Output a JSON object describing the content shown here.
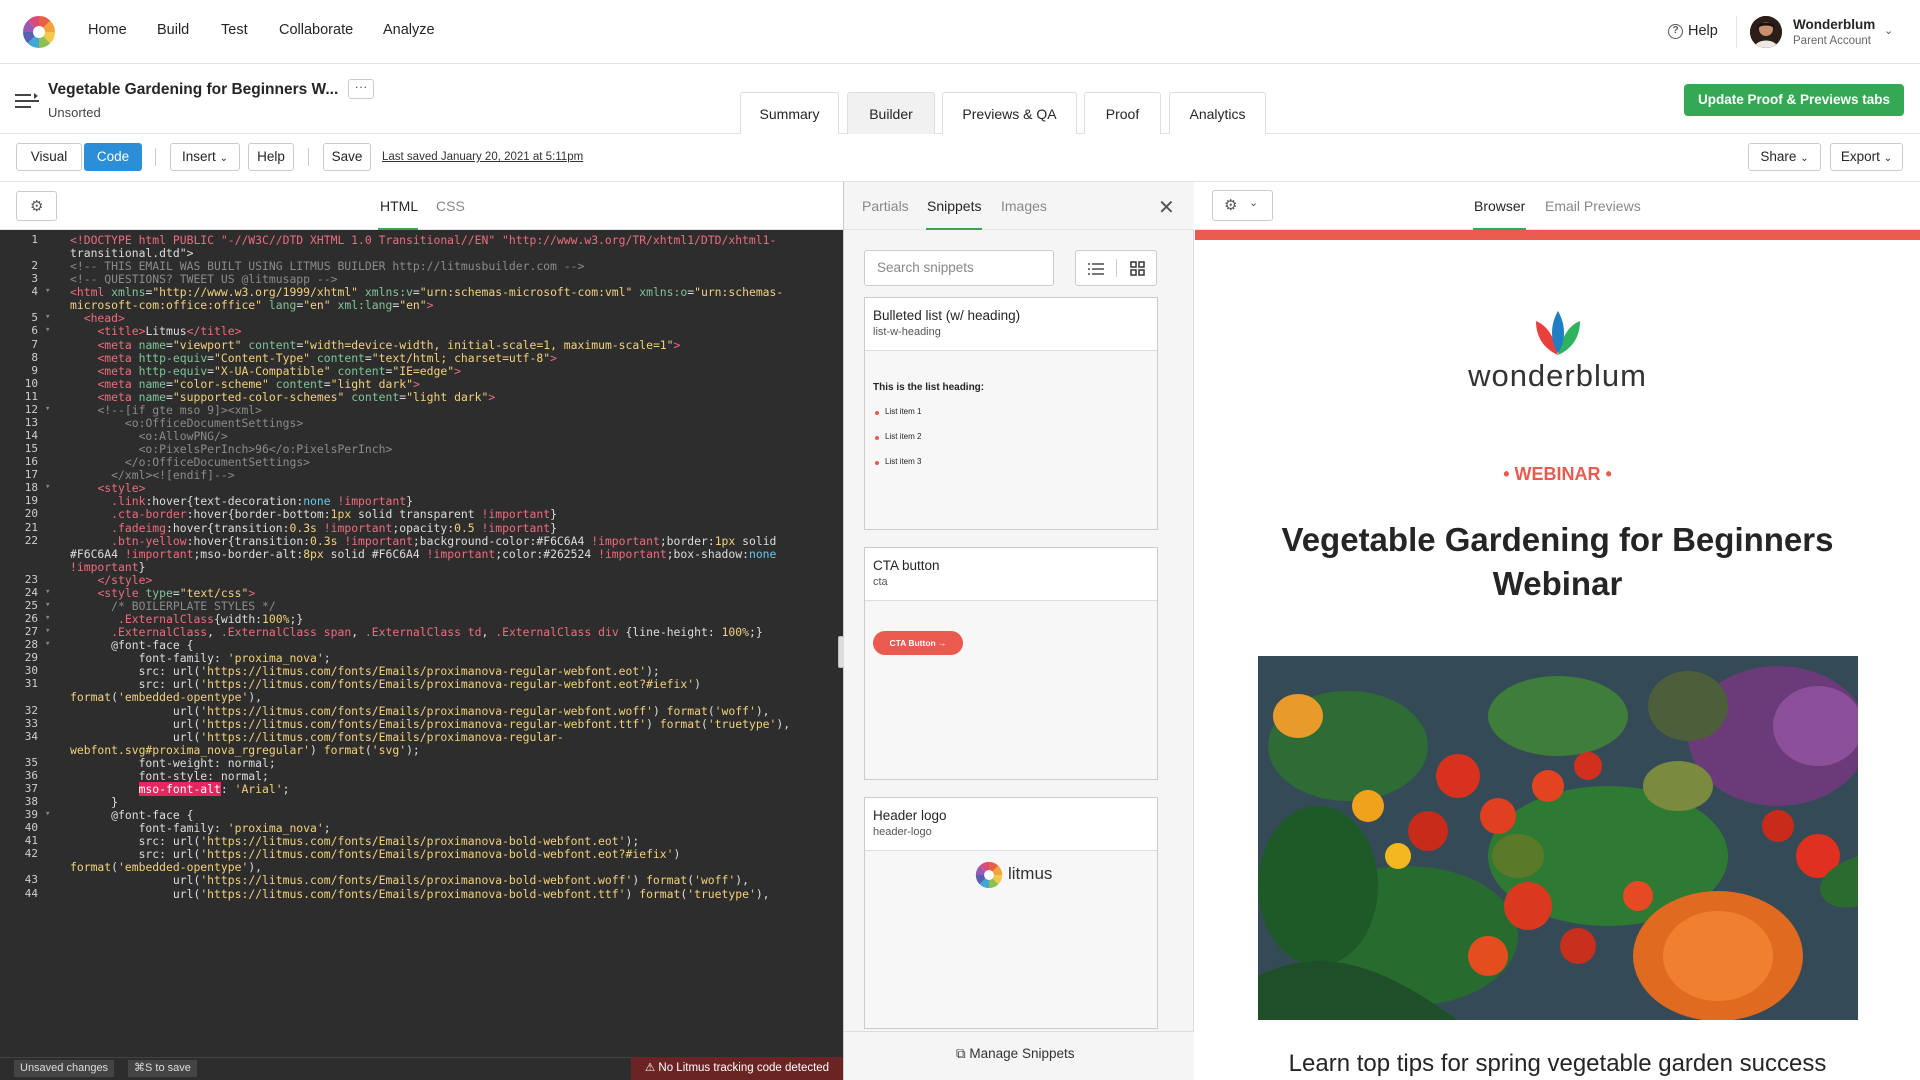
{
  "nav": {
    "items": [
      "Home",
      "Build",
      "Test",
      "Collaborate",
      "Analyze"
    ],
    "help": "Help"
  },
  "account": {
    "name": "Wonderblum",
    "sub": "Parent Account"
  },
  "project": {
    "title": "Vegetable Gardening for Beginners W...",
    "folder": "Unsorted",
    "more": "···"
  },
  "tabs": [
    "Summary",
    "Builder",
    "Previews & QA",
    "Proof",
    "Analytics"
  ],
  "active_tab": "Builder",
  "update_button": "Update Proof & Previews tabs",
  "toolbar": {
    "visual": "Visual",
    "code": "Code",
    "insert": "Insert",
    "help": "Help",
    "save": "Save",
    "last_saved": "Last saved January 20, 2021 at 5:11pm",
    "share": "Share",
    "export": "Export"
  },
  "editor": {
    "tabs": [
      "HTML",
      "CSS"
    ],
    "lines": [
      {
        "n": "1",
        "f": "",
        "y": 0,
        "html": "<span class='k'>&lt;!DOCTYPE html PUBLIC \"-//W3C//DTD XHTML 1.0 Transitional//EN\" \"http://www.w3.org/TR/xhtml1/DTD/xhtml1-</span>"
      },
      {
        "n": "",
        "f": "",
        "y": 1,
        "html": "<span class='v'>transitional.dtd\"&gt;</span>"
      },
      {
        "n": "2",
        "f": "",
        "y": 2,
        "html": "<span class='c'>&lt;!-- THIS EMAIL WAS BUILT USING LITMUS BUILDER http://litmusbuilder.com --&gt;</span>"
      },
      {
        "n": "3",
        "f": "",
        "y": 3,
        "html": "<span class='c'>&lt;!-- QUESTIONS? TWEET US @litmusapp --&gt;</span>"
      },
      {
        "n": "4",
        "f": "▾",
        "y": 4,
        "html": "<span class='k'>&lt;html</span> <span class='a'>xmlns</span>=<span class='s'>\"http://www.w3.org/1999/xhtml\"</span> <span class='a'>xmlns:v</span>=<span class='s'>\"urn:schemas-microsoft-com:vml\"</span> <span class='a'>xmlns:o</span>=<span class='s'>\"urn:schemas-</span>"
      },
      {
        "n": "",
        "f": "",
        "y": 5,
        "html": "<span class='s'>microsoft-com:office:office\"</span> <span class='a'>lang</span>=<span class='s'>\"en\"</span> <span class='a'>xml:lang</span>=<span class='s'>\"en\"</span><span class='k'>&gt;</span>"
      },
      {
        "n": "5",
        "f": "▾",
        "y": 6,
        "html": "  <span class='k'>&lt;head&gt;</span>"
      },
      {
        "n": "6",
        "f": "▾",
        "y": 7,
        "html": "    <span class='k'>&lt;title&gt;</span><span class='v'>Litmus</span><span class='k'>&lt;/title&gt;</span>"
      },
      {
        "n": "7",
        "f": "",
        "y": 8,
        "html": "    <span class='k'>&lt;meta</span> <span class='a'>name</span>=<span class='s'>\"viewport\"</span> <span class='a'>content</span>=<span class='s'>\"width=device-width, initial-scale=1, maximum-scale=1\"</span><span class='k'>&gt;</span>"
      },
      {
        "n": "8",
        "f": "",
        "y": 9,
        "html": "    <span class='k'>&lt;meta</span> <span class='a'>http-equiv</span>=<span class='s'>\"Content-Type\"</span> <span class='a'>content</span>=<span class='s'>\"text/html; charset=utf-8\"</span><span class='k'>&gt;</span>"
      },
      {
        "n": "9",
        "f": "",
        "y": 10,
        "html": "    <span class='k'>&lt;meta</span> <span class='a'>http-equiv</span>=<span class='s'>\"X-UA-Compatible\"</span> <span class='a'>content</span>=<span class='s'>\"IE=edge\"</span><span class='k'>&gt;</span>"
      },
      {
        "n": "10",
        "f": "",
        "y": 11,
        "html": "    <span class='k'>&lt;meta</span> <span class='a'>name</span>=<span class='s'>\"color-scheme\"</span> <span class='a'>content</span>=<span class='s'>\"light dark\"</span><span class='k'>&gt;</span>"
      },
      {
        "n": "11",
        "f": "",
        "y": 12,
        "html": "    <span class='k'>&lt;meta</span> <span class='a'>name</span>=<span class='s'>\"supported-color-schemes\"</span> <span class='a'>content</span>=<span class='s'>\"light dark\"</span><span class='k'>&gt;</span>"
      },
      {
        "n": "12",
        "f": "▾",
        "y": 13,
        "html": "    <span class='c'>&lt;!--[if gte mso 9]&gt;&lt;xml&gt;</span>"
      },
      {
        "n": "13",
        "f": "",
        "y": 14,
        "html": "        <span class='c'>&lt;o:OfficeDocumentSettings&gt;</span>"
      },
      {
        "n": "14",
        "f": "",
        "y": 15,
        "html": "          <span class='c'>&lt;o:AllowPNG/&gt;</span>"
      },
      {
        "n": "15",
        "f": "",
        "y": 16,
        "html": "          <span class='c'>&lt;o:PixelsPerInch&gt;96&lt;/o:PixelsPerInch&gt;</span>"
      },
      {
        "n": "16",
        "f": "",
        "y": 17,
        "html": "        <span class='c'>&lt;/o:OfficeDocumentSettings&gt;</span>"
      },
      {
        "n": "17",
        "f": "",
        "y": 18,
        "html": "      <span class='c'>&lt;/xml&gt;&lt;![endif]--&gt;</span>"
      },
      {
        "n": "18",
        "f": "▾",
        "y": 19,
        "html": "    <span class='k'>&lt;style&gt;</span>"
      },
      {
        "n": "19",
        "f": "",
        "y": 20,
        "html": "      <span class='k'>.link</span>:hover{text-decoration:<span class='p'>none</span> <span class='k'>!important</span>}"
      },
      {
        "n": "20",
        "f": "",
        "y": 21,
        "html": "      <span class='k'>.cta-border</span>:hover{border-bottom:<span class='s'>1px</span> solid transparent <span class='k'>!important</span>}"
      },
      {
        "n": "21",
        "f": "",
        "y": 22,
        "html": "      <span class='k'>.fadeimg</span>:hover{transition:<span class='s'>0.3s</span> <span class='k'>!important</span>;opacity:<span class='s'>0.5</span> <span class='k'>!important</span>}"
      },
      {
        "n": "22",
        "f": "",
        "y": 23,
        "html": "      <span class='k'>.btn-yellow</span>:hover{transition:<span class='s'>0.3s</span> <span class='k'>!important</span>;background-color:#F6C6A4 <span class='k'>!important</span>;border:<span class='s'>1px</span> solid"
      },
      {
        "n": "",
        "f": "",
        "y": 24,
        "html": "#F6C6A4 <span class='k'>!important</span>;mso-border-alt:<span class='s'>8px</span> solid #F6C6A4 <span class='k'>!important</span>;color:#262524 <span class='k'>!important</span>;box-shadow:<span class='p'>none</span>"
      },
      {
        "n": "",
        "f": "",
        "y": 25,
        "html": "<span class='k'>!important</span>}"
      },
      {
        "n": "23",
        "f": "",
        "y": 26,
        "html": "    <span class='k'>&lt;/style&gt;</span>"
      },
      {
        "n": "24",
        "f": "▾",
        "y": 27,
        "html": "    <span class='k'>&lt;style</span> <span class='a'>type</span>=<span class='s'>\"text/css\"</span><span class='k'>&gt;</span>"
      },
      {
        "n": "25",
        "f": "▾",
        "y": 28,
        "html": "      <span class='c'>/* BOILERPLATE STYLES */</span>"
      },
      {
        "n": "26",
        "f": "▾",
        "y": 29,
        "html": "       <span class='k'>.ExternalClass</span>{width:<span class='s'>100%</span>;}"
      },
      {
        "n": "27",
        "f": "▾",
        "y": 30,
        "html": "      <span class='k'>.ExternalClass</span>, <span class='k'>.ExternalClass span</span>, <span class='k'>.ExternalClass td</span>, <span class='k'>.ExternalClass div</span> {line-height: <span class='s'>100%</span>;}"
      },
      {
        "n": "28",
        "f": "▾",
        "y": 31,
        "html": "      <span class='v'>@font-face</span> {"
      },
      {
        "n": "29",
        "f": "",
        "y": 32,
        "html": "          font-family: <span class='s'>'proxima_nova'</span>;"
      },
      {
        "n": "30",
        "f": "",
        "y": 33,
        "html": "          src: url(<span class='s'>'https://litmus.com/fonts/Emails/proximanova-regular-webfont.eot'</span>);"
      },
      {
        "n": "31",
        "f": "",
        "y": 34,
        "html": "          src: url(<span class='s'>'https://litmus.com/fonts/Emails/proximanova-regular-webfont.eot?#iefix'</span>)"
      },
      {
        "n": "",
        "f": "",
        "y": 35,
        "html": "<span class='s'>format</span>(<span class='s'>'embedded-opentype'</span>),"
      },
      {
        "n": "32",
        "f": "",
        "y": 36,
        "html": "               url(<span class='s'>'https://litmus.com/fonts/Emails/proximanova-regular-webfont.woff'</span>) <span class='s'>format</span>(<span class='s'>'woff'</span>),"
      },
      {
        "n": "33",
        "f": "",
        "y": 37,
        "html": "               url(<span class='s'>'https://litmus.com/fonts/Emails/proximanova-regular-webfont.ttf'</span>) <span class='s'>format</span>(<span class='s'>'truetype'</span>),"
      },
      {
        "n": "34",
        "f": "",
        "y": 38,
        "html": "               url(<span class='s'>'https://litmus.com/fonts/Emails/proximanova-regular-</span>"
      },
      {
        "n": "",
        "f": "",
        "y": 39,
        "html": "<span class='s'>webfont.svg#proxima_nova_rgregular'</span>) <span class='s'>format</span>(<span class='s'>'svg'</span>);"
      },
      {
        "n": "35",
        "f": "",
        "y": 40,
        "html": "          font-weight: normal;"
      },
      {
        "n": "36",
        "f": "",
        "y": 41,
        "html": "          font-style: normal;"
      },
      {
        "n": "37",
        "f": "",
        "y": 42,
        "html": "          <span class='hl'>mso-font-alt</span>: <span class='s'>'Arial'</span>;"
      },
      {
        "n": "38",
        "f": "",
        "y": 43,
        "html": "      }"
      },
      {
        "n": "39",
        "f": "▾",
        "y": 44,
        "html": "      <span class='v'>@font-face</span> {"
      },
      {
        "n": "40",
        "f": "",
        "y": 45,
        "html": "          font-family: <span class='s'>'proxima_nova'</span>;"
      },
      {
        "n": "41",
        "f": "",
        "y": 46,
        "html": "          src: url(<span class='s'>'https://litmus.com/fonts/Emails/proximanova-bold-webfont.eot'</span>);"
      },
      {
        "n": "42",
        "f": "",
        "y": 47,
        "html": "          src: url(<span class='s'>'https://litmus.com/fonts/Emails/proximanova-bold-webfont.eot?#iefix'</span>)"
      },
      {
        "n": "",
        "f": "",
        "y": 48,
        "html": "<span class='s'>format</span>(<span class='s'>'embedded-opentype'</span>),"
      },
      {
        "n": "43",
        "f": "",
        "y": 49,
        "html": "               url(<span class='s'>'https://litmus.com/fonts/Emails/proximanova-bold-webfont.woff'</span>) <span class='s'>format</span>(<span class='s'>'woff'</span>),"
      },
      {
        "n": "44",
        "f": "",
        "y": 50,
        "html": "               url(<span class='s'>'https://litmus.com/fonts/Emails/proximanova-bold-webfont.ttf'</span>) <span class='s'>format</span>(<span class='s'>'truetype'</span>),"
      }
    ],
    "status_unsaved": "Unsaved changes",
    "status_shortcut": "⌘S to save",
    "warning": "No Litmus tracking code detected"
  },
  "snippets": {
    "tabs": [
      "Partials",
      "Snippets",
      "Images"
    ],
    "search_placeholder": "Search snippets",
    "cards": [
      {
        "title": "Bulleted list (w/ heading)",
        "slug": "list-w-heading",
        "heading": "This is the list heading:",
        "items": [
          "List item 1",
          "List item 2",
          "List item 3"
        ]
      },
      {
        "title": "CTA button",
        "slug": "cta",
        "button": "CTA Button →"
      },
      {
        "title": "Header logo",
        "slug": "header-logo",
        "logo": "litmus"
      }
    ],
    "manage": "Manage Snippets"
  },
  "preview": {
    "tabs": [
      "Browser",
      "Email Previews"
    ],
    "brand": "wonderblum",
    "eyebrow": "• WEBINAR •",
    "headline": "Vegetable Gardening for Beginners Webinar",
    "subline": "Learn top tips for spring vegetable garden success"
  },
  "colors": {
    "accent_green": "#35a853",
    "blue": "#2d8ed8",
    "red": "#ea5a4f"
  }
}
